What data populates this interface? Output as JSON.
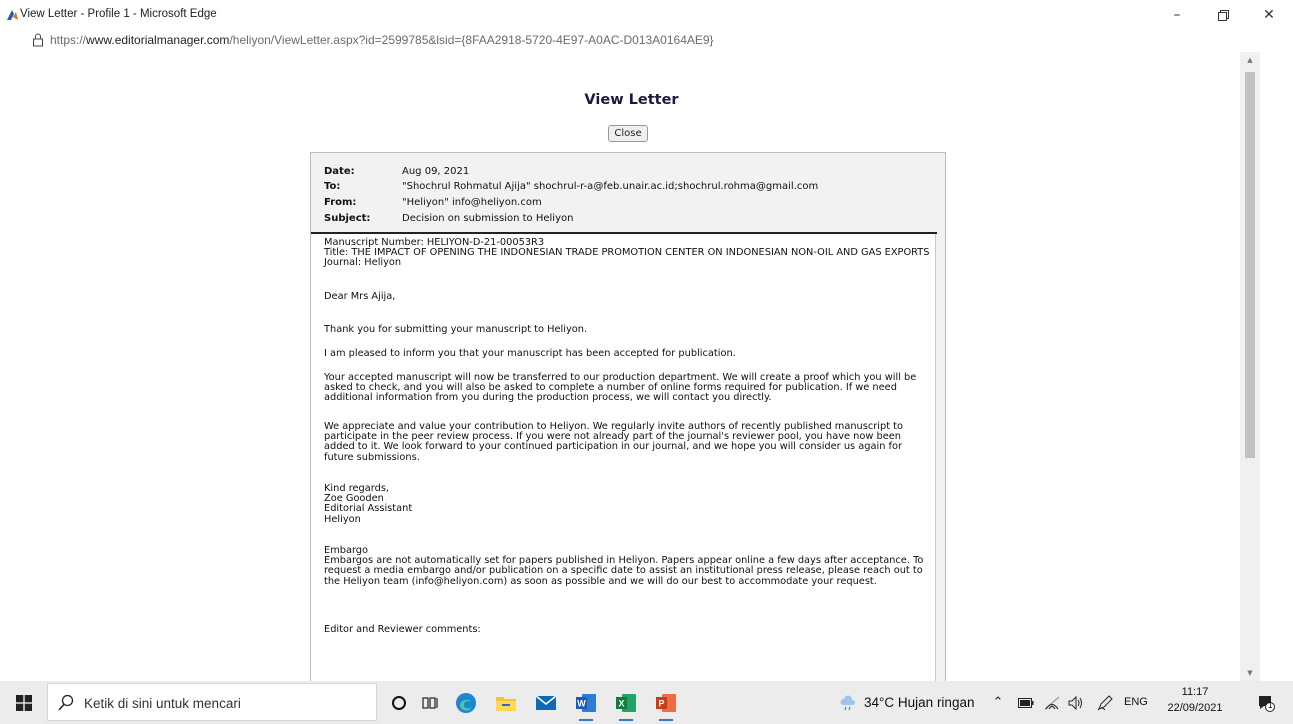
{
  "window": {
    "title": "View Letter - Profile 1 - Microsoft Edge",
    "url_prefix": "https://",
    "url_host": "www.editorialmanager.com",
    "url_rest": "/heliyon/ViewLetter.aspx?id=2599785&lsid={8FAA2918-5720-4E97-A0AC-D013A0164AE9}"
  },
  "page": {
    "heading": "View Letter",
    "close_label": "Close"
  },
  "letter": {
    "header": {
      "date_label": "Date:",
      "date_value": "Aug 09, 2021",
      "to_label": "To:",
      "to_value": "\"Shochrul Rohmatul Ajija\" shochrul-r-a@feb.unair.ac.id;shochrul.rohma@gmail.com",
      "from_label": "From:",
      "from_value": "\"Heliyon\" info@heliyon.com",
      "subject_label": "Subject:",
      "subject_value": "Decision on submission to Heliyon"
    },
    "body": {
      "manuscript": "Manuscript Number: HELIYON-D-21-00053R3\nTitle: THE IMPACT OF OPENING THE INDONESIAN TRADE PROMOTION CENTER ON INDONESIAN NON-OIL AND GAS EXPORTS\nJournal: Heliyon",
      "greeting": "Dear Mrs Ajija,",
      "thanks": "Thank you for submitting your manuscript to Heliyon.",
      "accepted": "I am pleased to inform you that your manuscript has been accepted for publication.",
      "production": "Your accepted manuscript will now be transferred to our production department. We will create a proof which you will be asked to check, and you will also be asked to complete a number of online forms required for publication. If we need additional information from you during the production process, we will contact you directly.",
      "appreciate": "We appreciate and value your contribution to Heliyon. We regularly invite authors of recently published manuscript to participate in the peer review process. If you were not already part of the journal's reviewer pool, you have now been added to it. We look forward to your continued participation in our journal, and we hope you will consider us again for future submissions.",
      "signoff": "Kind regards,\nZoe Gooden\nEditorial Assistant\nHeliyon",
      "embargo": "Embargo\nEmbargos are not automatically set for papers published in Heliyon. Papers appear online a few days after acceptance. To request a media embargo and/or publication on a specific date to assist an institutional press release, please reach out to the Heliyon team (info@heliyon.com) as soon as possible and we will do our best to accommodate your request.",
      "comments": "Editor and Reviewer comments:"
    }
  },
  "taskbar": {
    "search_placeholder": "Ketik di sini untuk mencari",
    "weather": "34°C  Hujan ringan",
    "language": "ENG",
    "time": "11:17",
    "date": "22/09/2021",
    "notification_count": "1",
    "apps": [
      "cortana",
      "task-view",
      "edge",
      "file-explorer",
      "mail",
      "word",
      "excel",
      "powerpoint"
    ]
  }
}
